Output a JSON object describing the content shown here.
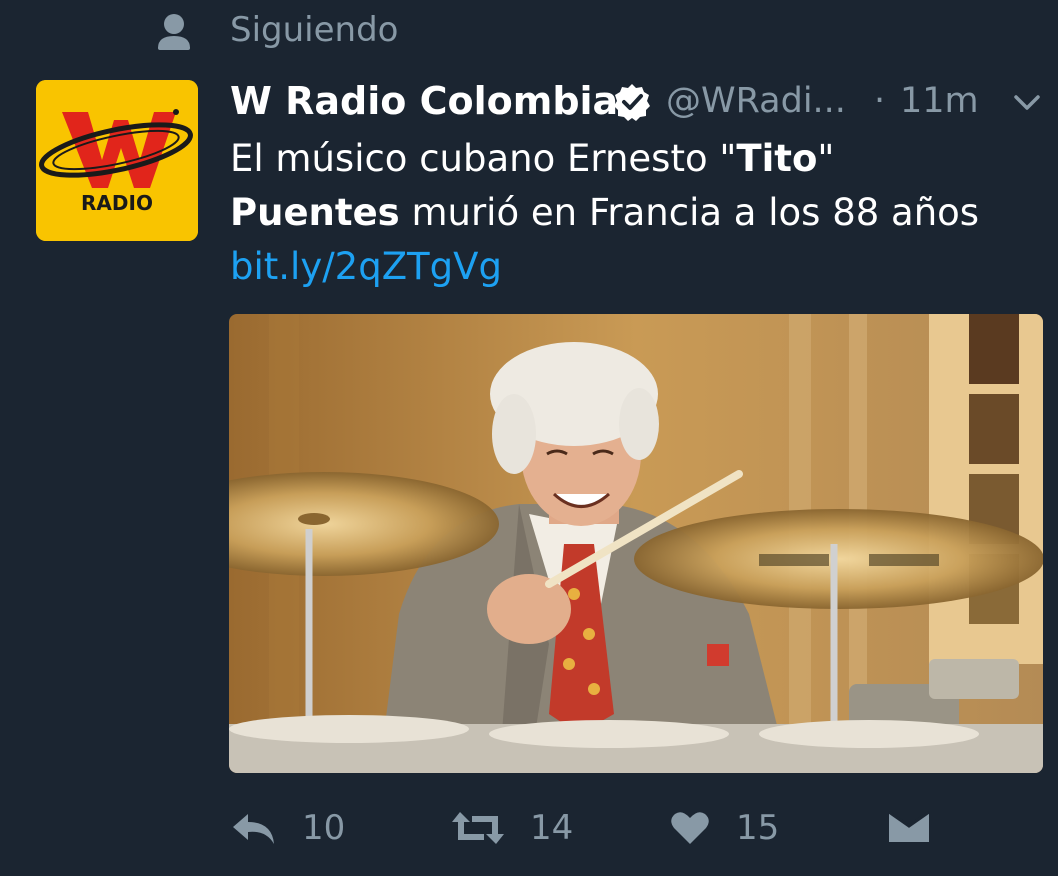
{
  "context": {
    "icon": "person-icon",
    "label": "Siguiendo"
  },
  "tweet": {
    "avatar": {
      "logo_text": "RADIO",
      "brand_color": "#f9c400",
      "logo_red": "#e1251b"
    },
    "display_name": "W Radio Colombia",
    "verified": true,
    "handle": "@WRadi...",
    "separator": "·",
    "time": "11m",
    "text": {
      "part1": "El músico cubano Ernesto \"",
      "bold1": "Tito",
      "part2": "\"",
      "bold2": "Puentes",
      "part3": " murió en Francia a los 88 años",
      "link": "bit.ly/2qZTgVg"
    },
    "media": {
      "description_icon": "photo-drummer"
    }
  },
  "actions": {
    "reply": {
      "icon": "reply-icon",
      "count": "10"
    },
    "retweet": {
      "icon": "retweet-icon",
      "count": "14"
    },
    "like": {
      "icon": "heart-icon",
      "count": "15"
    },
    "dm": {
      "icon": "envelope-icon"
    }
  },
  "colors": {
    "background": "#1b2531",
    "muted": "#8899a6",
    "link": "#1da1f2"
  }
}
